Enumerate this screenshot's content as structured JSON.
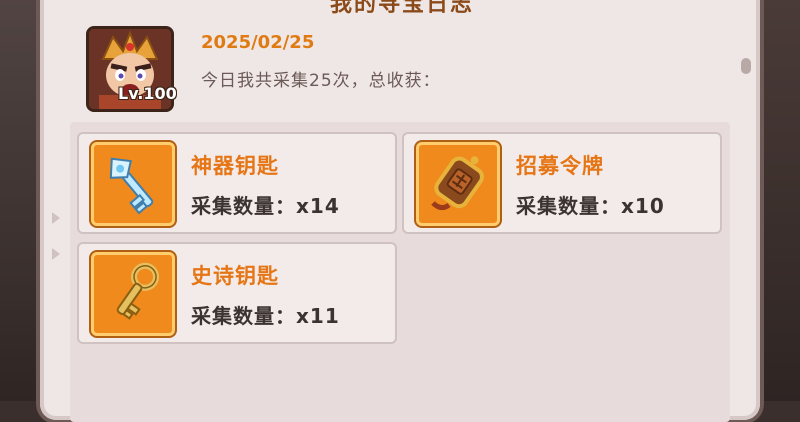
{
  "panel": {
    "title": "我的寻宝日志"
  },
  "entry": {
    "date": "2025/02/25",
    "summary": "今日我共采集25次，总收获：",
    "avatar": {
      "level_label": "Lv.100"
    }
  },
  "items": [
    {
      "name": "神器钥匙",
      "count_label": "采集数量：x14",
      "icon": "artifact-key-icon"
    },
    {
      "name": "招募令牌",
      "count_label": "采集数量：x10",
      "icon": "recruit-token-icon"
    },
    {
      "name": "史诗钥匙",
      "count_label": "采集数量：x11",
      "icon": "epic-key-icon"
    }
  ],
  "colors": {
    "accent_orange": "#e67615",
    "date_orange": "#e07a12",
    "panel_bg": "#efe7e6",
    "icon_bg": "#f08a1c"
  }
}
